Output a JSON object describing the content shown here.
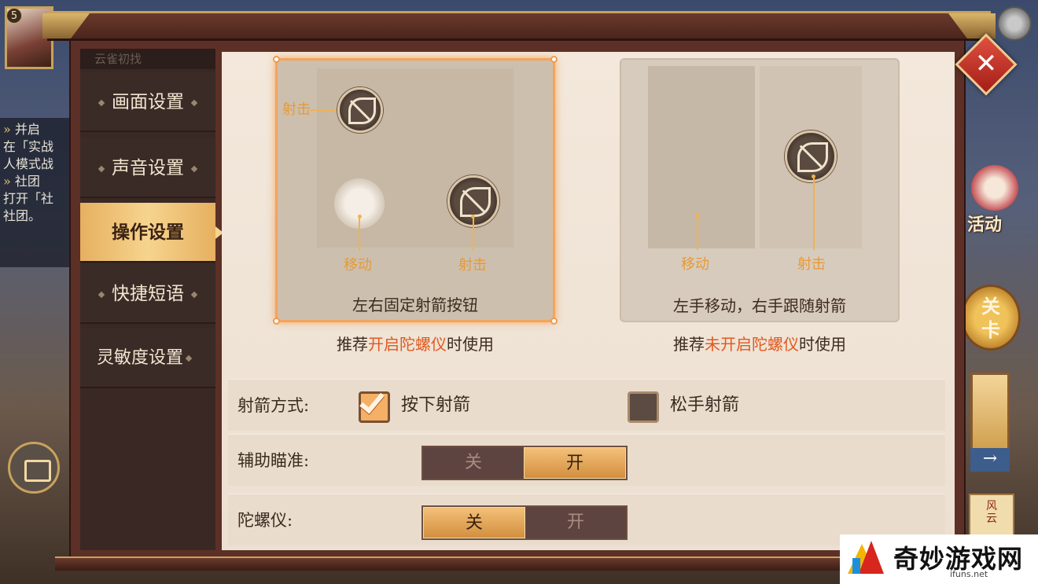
{
  "player": {
    "level": "5"
  },
  "background": {
    "panel_rows": [
      {
        "tag": "»",
        "text": "并启"
      },
      {
        "tag": "",
        "text": "在「实战"
      },
      {
        "tag": "",
        "text": "人模式战"
      },
      {
        "tag": "»",
        "text": "社团"
      },
      {
        "tag": "",
        "text": "打开「社"
      },
      {
        "tag": "",
        "text": "社团。"
      }
    ],
    "activity_label": "活动",
    "stage_label": "关\n卡",
    "scroll_label": "风\n云"
  },
  "sidebar": {
    "header": "云雀初找",
    "items": [
      {
        "label": "画面设置",
        "active": false
      },
      {
        "label": "声音设置",
        "active": false
      },
      {
        "label": "操作设置",
        "active": true
      },
      {
        "label": "快捷短语",
        "active": false
      },
      {
        "label": "灵敏度设置",
        "active": false
      }
    ]
  },
  "schemes": [
    {
      "caption": "左右固定射箭按钮",
      "selected": true,
      "labels": {
        "shoot_top": "射击",
        "move": "移动",
        "shoot": "射击"
      },
      "recommend": {
        "prefix": "推荐",
        "highlight": "开启陀螺仪",
        "suffix": "时使用"
      }
    },
    {
      "caption": "左手移动，右手跟随射箭",
      "selected": false,
      "labels": {
        "move": "移动",
        "shoot": "射击"
      },
      "recommend": {
        "prefix": "推荐",
        "highlight": "未开启陀螺仪",
        "suffix": "时使用"
      }
    }
  ],
  "options": {
    "shoot_mode": {
      "label": "射箭方式:",
      "choices": [
        {
          "label": "按下射箭",
          "checked": true
        },
        {
          "label": "松手射箭",
          "checked": false
        }
      ]
    },
    "aim_assist": {
      "label": "辅助瞄准:",
      "off": "关",
      "on": "开",
      "value": "开"
    },
    "gyroscope": {
      "label": "陀螺仪:",
      "off": "关",
      "on": "开",
      "value": "关"
    }
  },
  "watermark": {
    "text": "奇妙游戏网",
    "url": "ifuns.net"
  },
  "colors": {
    "accent": "#f4a45c",
    "highlight_text": "#e0591f",
    "toggle_on": "#e2a456"
  }
}
